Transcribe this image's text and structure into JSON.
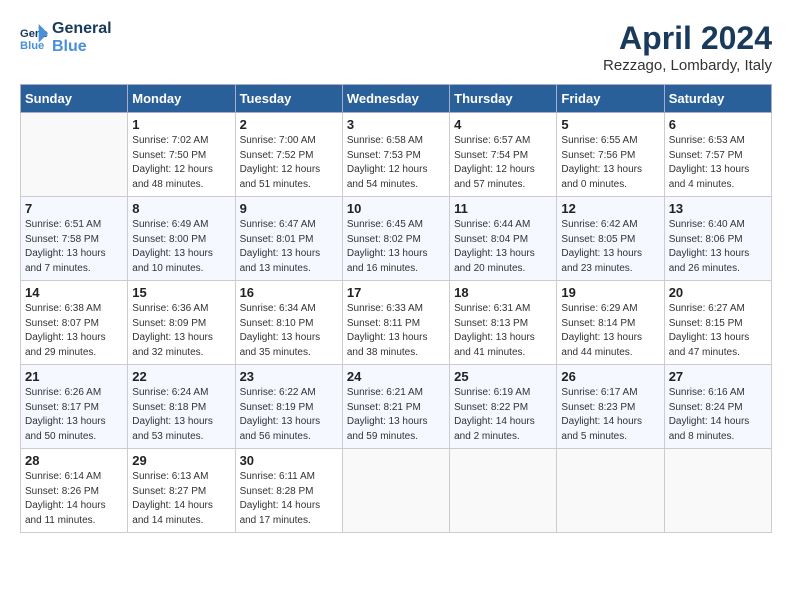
{
  "header": {
    "logo_general": "General",
    "logo_blue": "Blue",
    "title": "April 2024",
    "location": "Rezzago, Lombardy, Italy"
  },
  "weekdays": [
    "Sunday",
    "Monday",
    "Tuesday",
    "Wednesday",
    "Thursday",
    "Friday",
    "Saturday"
  ],
  "weeks": [
    [
      {
        "day": "",
        "info": ""
      },
      {
        "day": "1",
        "info": "Sunrise: 7:02 AM\nSunset: 7:50 PM\nDaylight: 12 hours\nand 48 minutes."
      },
      {
        "day": "2",
        "info": "Sunrise: 7:00 AM\nSunset: 7:52 PM\nDaylight: 12 hours\nand 51 minutes."
      },
      {
        "day": "3",
        "info": "Sunrise: 6:58 AM\nSunset: 7:53 PM\nDaylight: 12 hours\nand 54 minutes."
      },
      {
        "day": "4",
        "info": "Sunrise: 6:57 AM\nSunset: 7:54 PM\nDaylight: 12 hours\nand 57 minutes."
      },
      {
        "day": "5",
        "info": "Sunrise: 6:55 AM\nSunset: 7:56 PM\nDaylight: 13 hours\nand 0 minutes."
      },
      {
        "day": "6",
        "info": "Sunrise: 6:53 AM\nSunset: 7:57 PM\nDaylight: 13 hours\nand 4 minutes."
      }
    ],
    [
      {
        "day": "7",
        "info": "Sunrise: 6:51 AM\nSunset: 7:58 PM\nDaylight: 13 hours\nand 7 minutes."
      },
      {
        "day": "8",
        "info": "Sunrise: 6:49 AM\nSunset: 8:00 PM\nDaylight: 13 hours\nand 10 minutes."
      },
      {
        "day": "9",
        "info": "Sunrise: 6:47 AM\nSunset: 8:01 PM\nDaylight: 13 hours\nand 13 minutes."
      },
      {
        "day": "10",
        "info": "Sunrise: 6:45 AM\nSunset: 8:02 PM\nDaylight: 13 hours\nand 16 minutes."
      },
      {
        "day": "11",
        "info": "Sunrise: 6:44 AM\nSunset: 8:04 PM\nDaylight: 13 hours\nand 20 minutes."
      },
      {
        "day": "12",
        "info": "Sunrise: 6:42 AM\nSunset: 8:05 PM\nDaylight: 13 hours\nand 23 minutes."
      },
      {
        "day": "13",
        "info": "Sunrise: 6:40 AM\nSunset: 8:06 PM\nDaylight: 13 hours\nand 26 minutes."
      }
    ],
    [
      {
        "day": "14",
        "info": "Sunrise: 6:38 AM\nSunset: 8:07 PM\nDaylight: 13 hours\nand 29 minutes."
      },
      {
        "day": "15",
        "info": "Sunrise: 6:36 AM\nSunset: 8:09 PM\nDaylight: 13 hours\nand 32 minutes."
      },
      {
        "day": "16",
        "info": "Sunrise: 6:34 AM\nSunset: 8:10 PM\nDaylight: 13 hours\nand 35 minutes."
      },
      {
        "day": "17",
        "info": "Sunrise: 6:33 AM\nSunset: 8:11 PM\nDaylight: 13 hours\nand 38 minutes."
      },
      {
        "day": "18",
        "info": "Sunrise: 6:31 AM\nSunset: 8:13 PM\nDaylight: 13 hours\nand 41 minutes."
      },
      {
        "day": "19",
        "info": "Sunrise: 6:29 AM\nSunset: 8:14 PM\nDaylight: 13 hours\nand 44 minutes."
      },
      {
        "day": "20",
        "info": "Sunrise: 6:27 AM\nSunset: 8:15 PM\nDaylight: 13 hours\nand 47 minutes."
      }
    ],
    [
      {
        "day": "21",
        "info": "Sunrise: 6:26 AM\nSunset: 8:17 PM\nDaylight: 13 hours\nand 50 minutes."
      },
      {
        "day": "22",
        "info": "Sunrise: 6:24 AM\nSunset: 8:18 PM\nDaylight: 13 hours\nand 53 minutes."
      },
      {
        "day": "23",
        "info": "Sunrise: 6:22 AM\nSunset: 8:19 PM\nDaylight: 13 hours\nand 56 minutes."
      },
      {
        "day": "24",
        "info": "Sunrise: 6:21 AM\nSunset: 8:21 PM\nDaylight: 13 hours\nand 59 minutes."
      },
      {
        "day": "25",
        "info": "Sunrise: 6:19 AM\nSunset: 8:22 PM\nDaylight: 14 hours\nand 2 minutes."
      },
      {
        "day": "26",
        "info": "Sunrise: 6:17 AM\nSunset: 8:23 PM\nDaylight: 14 hours\nand 5 minutes."
      },
      {
        "day": "27",
        "info": "Sunrise: 6:16 AM\nSunset: 8:24 PM\nDaylight: 14 hours\nand 8 minutes."
      }
    ],
    [
      {
        "day": "28",
        "info": "Sunrise: 6:14 AM\nSunset: 8:26 PM\nDaylight: 14 hours\nand 11 minutes."
      },
      {
        "day": "29",
        "info": "Sunrise: 6:13 AM\nSunset: 8:27 PM\nDaylight: 14 hours\nand 14 minutes."
      },
      {
        "day": "30",
        "info": "Sunrise: 6:11 AM\nSunset: 8:28 PM\nDaylight: 14 hours\nand 17 minutes."
      },
      {
        "day": "",
        "info": ""
      },
      {
        "day": "",
        "info": ""
      },
      {
        "day": "",
        "info": ""
      },
      {
        "day": "",
        "info": ""
      }
    ]
  ]
}
